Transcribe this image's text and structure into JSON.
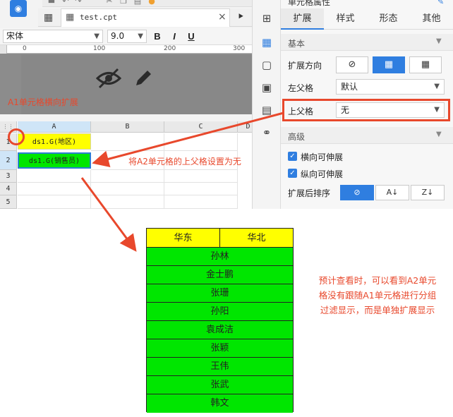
{
  "editor": {
    "tab": {
      "file_name": "test.cpt",
      "close": "×"
    },
    "font": {
      "family": "宋体",
      "size": "9.0",
      "bold": "B",
      "italic": "I",
      "underline": "U"
    },
    "ruler": {
      "t0": "0",
      "t1": "100",
      "t2": "200",
      "t3": "300"
    },
    "annotations": {
      "a1_note": "A1单元格横向扩展",
      "a2_note": "将A2单元格的上父格设置为无"
    },
    "grid": {
      "columns": [
        "A",
        "B",
        "C",
        "D"
      ],
      "rows": [
        "1",
        "2",
        "3",
        "4",
        "5"
      ],
      "a1": "ds1.G(地区)",
      "a2": "ds1.G(销售员)"
    }
  },
  "panel": {
    "title": "单元格属性",
    "tabs": [
      "扩展",
      "样式",
      "形态",
      "其他"
    ],
    "active_tab": "扩展",
    "basic_section": "基本",
    "expand_direction_label": "扩展方向",
    "left_parent_label": "左父格",
    "left_parent_value": "默认",
    "top_parent_label": "上父格",
    "top_parent_value": "无",
    "advanced_section": "高级",
    "horizontal_expand_label": "横向可伸展",
    "vertical_expand_label": "纵向可伸展",
    "sort_label": "扩展后排序"
  },
  "preview_table": {
    "headers": [
      "华东",
      "华北"
    ],
    "rows": [
      "孙林",
      "金士鹏",
      "张珊",
      "孙阳",
      "袁成洁",
      "张颖",
      "王伟",
      "张武",
      "韩文"
    ]
  },
  "bottom_note": "预计查看时，可以看到A2单元格没有跟随A1单元格进行分组过滤显示，而是单独扩展显示",
  "colors": {
    "accent": "#2f7ee0",
    "annotation": "#e8482c",
    "yellow_cell": "#ffff00",
    "green_cell": "#00e600"
  }
}
